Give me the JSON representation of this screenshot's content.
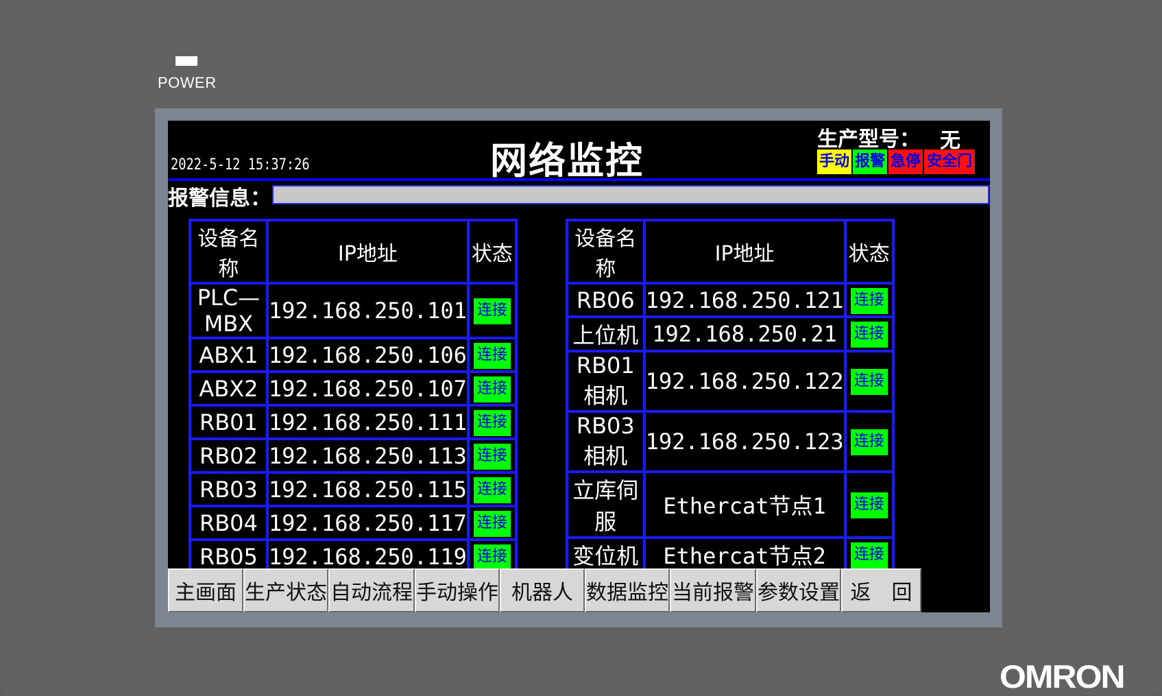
{
  "device": {
    "power_label": "POWER",
    "brand": "OMRON"
  },
  "header": {
    "datetime": "2022-5-12 15:37:26",
    "title": "网络监控",
    "model_label": "生产型号：",
    "model_value": "无",
    "status_indicators": [
      {
        "label": "手动",
        "bg": "#ffff00",
        "fg": "#0000e0"
      },
      {
        "label": "报警",
        "bg": "#00ff00",
        "fg": "#0000e0"
      },
      {
        "label": "急停",
        "bg": "#ff1010",
        "fg": "#0000e0"
      },
      {
        "label": "安全门",
        "bg": "#ff1010",
        "fg": "#0000e0"
      }
    ]
  },
  "alarm": {
    "label": "报警信息：",
    "message": ""
  },
  "tables": {
    "headers": [
      "设备名称",
      "IP地址",
      "状态"
    ],
    "left_rows": [
      {
        "name": "PLC—MBX",
        "ip": "192.168.250.101",
        "status": "连接"
      },
      {
        "name": "ABX1",
        "ip": "192.168.250.106",
        "status": "连接"
      },
      {
        "name": "ABX2",
        "ip": "192.168.250.107",
        "status": "连接"
      },
      {
        "name": "RB01",
        "ip": "192.168.250.111",
        "status": "连接"
      },
      {
        "name": "RB02",
        "ip": "192.168.250.113",
        "status": "连接"
      },
      {
        "name": "RB03",
        "ip": "192.168.250.115",
        "status": "连接"
      },
      {
        "name": "RB04",
        "ip": "192.168.250.117",
        "status": "连接"
      },
      {
        "name": "RB05",
        "ip": "192.168.250.119",
        "status": "连接"
      }
    ],
    "right_rows": [
      {
        "name": "RB06",
        "ip": "192.168.250.121",
        "status": "连接"
      },
      {
        "name": "上位机",
        "ip": "192.168.250.21",
        "status": "连接"
      },
      {
        "name": "RB01相机",
        "ip": "192.168.250.122",
        "status": "连接"
      },
      {
        "name": "RB03相机",
        "ip": "192.168.250.123",
        "status": "连接"
      },
      {
        "name": "立库伺服",
        "ip": "Ethercat节点1",
        "status": "连接"
      },
      {
        "name": "变位机",
        "ip": "Ethercat节点2",
        "status": "连接"
      },
      {
        "name": "",
        "ip": "",
        "status": ""
      },
      {
        "name": "",
        "ip": "",
        "status": ""
      }
    ]
  },
  "nav": [
    "主画面",
    "生产状态",
    "自动流程",
    "手动操作",
    "机器人",
    "数据监控",
    "当前报警",
    "参数设置",
    "返　回"
  ],
  "colors": {
    "grid": "#1a1aff",
    "connected": "#00ff00",
    "screen_bg": "#000000"
  }
}
